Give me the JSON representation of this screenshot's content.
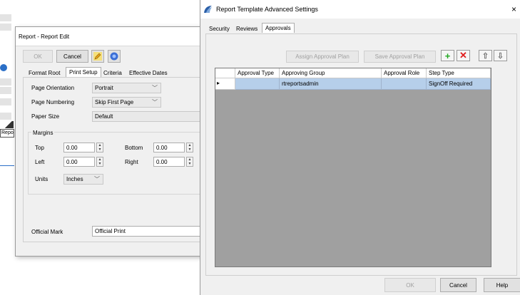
{
  "background_window": {
    "left_strip_label": "Repor"
  },
  "report_edit": {
    "title": "Report - Report Edit",
    "ok_label": "OK",
    "cancel_label": "Cancel",
    "tabs": [
      {
        "label": "Format Root"
      },
      {
        "label": "Print Setup"
      },
      {
        "label": "Criteria"
      },
      {
        "label": "Effective Dates"
      }
    ],
    "page_orientation_label": "Page Orientation",
    "page_orientation_value": "Portrait",
    "page_numbering_label": "Page Numbering",
    "page_numbering_value": "Skip First Page",
    "paper_size_label": "Paper Size",
    "paper_size_value": "Default",
    "margins_label": "Margins",
    "top_label": "Top",
    "top_value": "0.00",
    "bottom_label": "Bottom",
    "bottom_value": "0.00",
    "left_label": "Left",
    "left_value": "0.00",
    "right_label": "Right",
    "right_value": "0.00",
    "units_label": "Units",
    "units_value": "Inches",
    "official_mark_label": "Official Mark",
    "official_mark_value": "Official Print"
  },
  "advanced": {
    "title": "Report Template Advanced Settings",
    "close_glyph": "×",
    "tabs": [
      {
        "label": "Security"
      },
      {
        "label": "Reviews"
      },
      {
        "label": "Approvals"
      }
    ],
    "assign_plan_label": "Assign Approval Plan",
    "save_plan_label": "Save Approval Plan",
    "add_glyph": "+",
    "delete_glyph": "✕",
    "up_glyph": "⇧",
    "down_glyph": "⇩",
    "columns": [
      "Approval Type",
      "Approving Group",
      "Approval Role",
      "Step Type"
    ],
    "rows": [
      {
        "indicator": "▸",
        "approval_type": "",
        "approving_group": "rtreportsadmin",
        "approval_role": "",
        "step_type": "SignOff Required"
      }
    ],
    "ok_label": "OK",
    "cancel_label": "Cancel",
    "help_label": "Help",
    "colors": {
      "add": "#22a822",
      "delete": "#e01b1b",
      "row_selected": "#b6cfea",
      "grid_bg": "#a0a0a0"
    }
  }
}
